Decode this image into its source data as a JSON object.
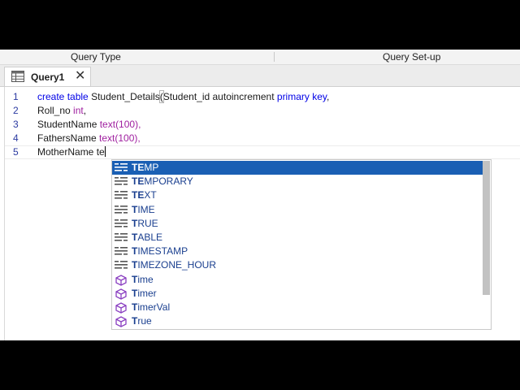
{
  "ribbon": {
    "groups": [
      "Query Type",
      "Query Set-up"
    ]
  },
  "tabs": [
    {
      "label": "Query1",
      "icon": "query-table-icon",
      "close": "✕"
    }
  ],
  "editor": {
    "lines": [
      {
        "n": "1",
        "segments": [
          {
            "t": "create",
            "c": "kw"
          },
          {
            "t": " ",
            "c": ""
          },
          {
            "t": "table",
            "c": "kw"
          },
          {
            "t": " Student_Details",
            "c": ""
          },
          {
            "t": "(",
            "c": "br"
          },
          {
            "t": "Student_id autoincrement ",
            "c": ""
          },
          {
            "t": "primary key",
            "c": "kw"
          },
          {
            "t": ",",
            "c": ""
          }
        ]
      },
      {
        "n": "2",
        "segments": [
          {
            "t": "Roll_no ",
            "c": ""
          },
          {
            "t": "int",
            "c": "ty"
          },
          {
            "t": ",",
            "c": ""
          }
        ]
      },
      {
        "n": "3",
        "segments": [
          {
            "t": "StudentName ",
            "c": ""
          },
          {
            "t": "text",
            "c": "ty"
          },
          {
            "t": "(100),",
            "c": "ty"
          }
        ]
      },
      {
        "n": "4",
        "segments": [
          {
            "t": "FathersName ",
            "c": ""
          },
          {
            "t": "text",
            "c": "ty"
          },
          {
            "t": "(100),",
            "c": "ty"
          }
        ]
      },
      {
        "n": "5",
        "segments": [
          {
            "t": "MotherName te",
            "c": ""
          }
        ]
      }
    ]
  },
  "autocomplete": {
    "items": [
      {
        "prefix": "TE",
        "rest": "MP",
        "icon": "keyword-icon",
        "selected": true
      },
      {
        "prefix": "TE",
        "rest": "MPORARY",
        "icon": "keyword-icon"
      },
      {
        "prefix": "TE",
        "rest": "XT",
        "icon": "keyword-icon"
      },
      {
        "prefix": "T",
        "rest": "IME",
        "icon": "keyword-icon"
      },
      {
        "prefix": "T",
        "rest": "RUE",
        "icon": "keyword-icon"
      },
      {
        "prefix": "T",
        "rest": "ABLE",
        "icon": "keyword-icon"
      },
      {
        "prefix": "T",
        "rest": "IMESTAMP",
        "icon": "keyword-icon"
      },
      {
        "prefix": "T",
        "rest": "IMEZONE_HOUR",
        "icon": "keyword-icon"
      },
      {
        "prefix": "T",
        "rest": "ime",
        "icon": "object-icon"
      },
      {
        "prefix": "T",
        "rest": "imer",
        "icon": "object-icon"
      },
      {
        "prefix": "T",
        "rest": "imerVal",
        "icon": "object-icon"
      },
      {
        "prefix": "T",
        "rest": "rue",
        "icon": "object-icon"
      }
    ]
  },
  "colors": {
    "keyword": "#0000e6",
    "type": "#a020a0",
    "selection": "#1a5fb4",
    "object_icon": "#8a3fc1"
  }
}
